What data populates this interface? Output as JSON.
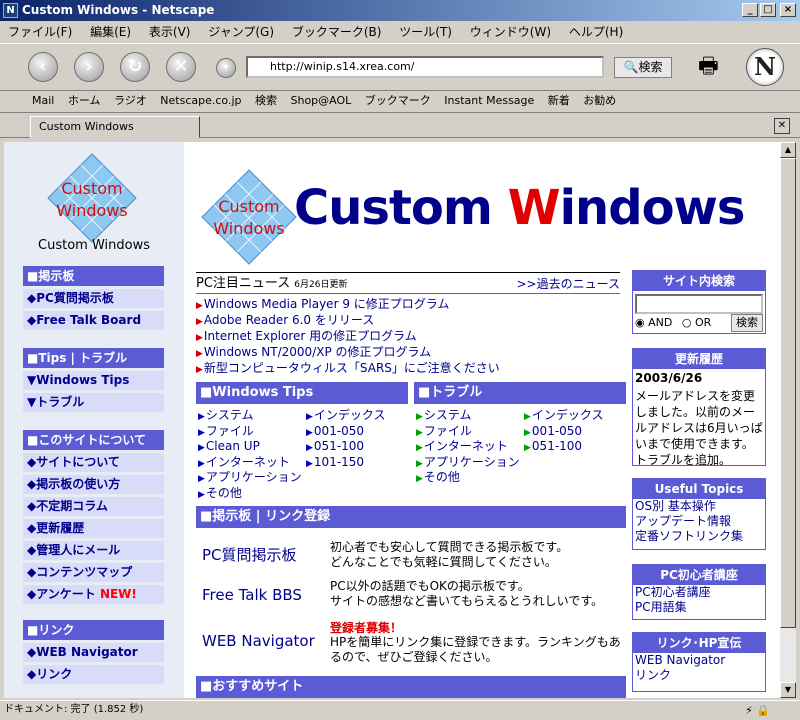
{
  "window": {
    "title": "Custom Windows - Netscape",
    "icon": "N"
  },
  "menu": [
    "ファイル(F)",
    "編集(E)",
    "表示(V)",
    "ジャンプ(G)",
    "ブックマーク(B)",
    "ツール(T)",
    "ウィンドウ(W)",
    "ヘルプ(H)"
  ],
  "nav": {
    "url": "http://winip.s14.xrea.com/",
    "search_label": "検索",
    "logo": "N"
  },
  "personal_toolbar": [
    "Mail",
    "ホーム",
    "ラジオ",
    "Netscape.co.jp",
    "検索",
    "Shop@AOL",
    "ブックマーク",
    "Instant Message",
    "新着",
    "お勧め"
  ],
  "tab": {
    "label": "Custom Windows"
  },
  "status": {
    "text": "ドキュメント: 完了 (1.852 秒)"
  },
  "site": {
    "logo_line1": "Custom",
    "logo_line2": "Windows",
    "logo_caption": "Custom Windows",
    "title_part1": "Custom ",
    "title_w": "W",
    "title_part2": "indows",
    "left": {
      "bbs": {
        "head": "■掲示板",
        "items": [
          "◆PC質問掲示板",
          "◆Free Talk Board"
        ]
      },
      "tips": {
        "head": "■Tips | トラブル",
        "items": [
          "▼Windows Tips",
          "▼トラブル"
        ]
      },
      "about": {
        "head": "■このサイトについて",
        "items": [
          "◆サイトについて",
          "◆掲示板の使い方",
          "◆不定期コラム",
          "◆更新履歴",
          "◆管理人にメール",
          "◆コンテンツマップ",
          "◆アンケート"
        ],
        "new_badge": "NEW!"
      },
      "links": {
        "head": "■リンク",
        "items": [
          "◆WEB Navigator",
          "◆リンク"
        ]
      }
    },
    "news": {
      "title": "PC注目ニュース",
      "date": "6月26日更新",
      "past": ">>過去のニュース",
      "items": [
        "Windows Media Player 9 に修正プログラム",
        "Adobe Reader 6.0 をリリース",
        "Internet Explorer 用の修正プログラム",
        "Windows NT/2000/XP の修正プログラム",
        "新型コンピュータウィルス「SARS」にご注意ください"
      ]
    },
    "tips": {
      "head": "■Windows Tips",
      "col1": [
        "システム",
        "ファイル",
        "Clean UP",
        "インターネット",
        "アプリケーション",
        "その他"
      ],
      "col2": [
        "インデックス",
        "001-050",
        "051-100",
        "101-150"
      ]
    },
    "trouble": {
      "head": "■トラブル",
      "col1": [
        "システム",
        "ファイル",
        "インターネット",
        "アプリケーション",
        "その他"
      ],
      "col2": [
        "インデックス",
        "001-050",
        "051-100"
      ]
    },
    "bbs": {
      "head": "■掲示板 | リンク登録",
      "pc_label": "PC質問掲示板",
      "pc_desc1": "初心者でも安心して質問できる掲示板です。",
      "pc_desc2": "どんなことでも気軽に質問してください。",
      "ft_label": "Free Talk BBS",
      "ft_desc1": "PC以外の話題でもOKの掲示板です。",
      "ft_desc2": "サイトの感想など書いてもらえるとうれしいです。",
      "recruit": "登録者募集！",
      "wn_label": "WEB Navigator",
      "wn_desc1": "HPを簡単にリンク集に登録できます。ランキングもあ",
      "wn_desc2": "るので、ぜひご登録ください。"
    },
    "recommend": {
      "head": "■おすすめサイト"
    },
    "search": {
      "head": "サイト内検索",
      "and": "AND",
      "or": "OR",
      "button": "検索"
    },
    "history": {
      "head": "更新履歴",
      "date": "2003/6/26",
      "text": "メールアドレスを変更しました。以前のメールアドレスは6月いっぱいまで使用できます。トラブルを追加。"
    },
    "useful": {
      "head": "Useful Topics",
      "items": [
        "OS別 基本操作",
        "アップデート情報",
        "定番ソフトリンク集"
      ]
    },
    "beginner": {
      "head": "PC初心者講座",
      "items": [
        "PC初心者講座",
        "PC用語集"
      ]
    },
    "linkhp": {
      "head": "リンク･HP宣伝",
      "items": [
        "WEB Navigator",
        "リンク"
      ]
    }
  }
}
